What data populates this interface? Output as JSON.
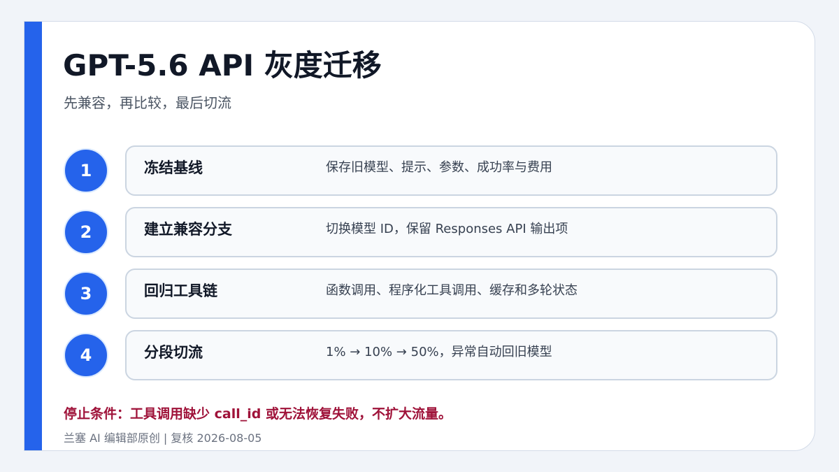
{
  "header": {
    "title": "GPT-5.6 API 灰度迁移",
    "subtitle": "先兼容，再比较，最后切流"
  },
  "steps": [
    {
      "number": "1",
      "name": "冻结基线",
      "description": "保存旧模型、提示、参数、成功率与费用"
    },
    {
      "number": "2",
      "name": "建立兼容分支",
      "description": "切换模型 ID，保留 Responses API 输出项"
    },
    {
      "number": "3",
      "name": "回归工具链",
      "description": "函数调用、程序化工具调用、缓存和多轮状态"
    },
    {
      "number": "4",
      "name": "分段切流",
      "description": "1% → 10% → 50%，异常自动回旧模型"
    }
  ],
  "stop_condition": "停止条件：工具调用缺少 call_id 或无法恢复失败，不扩大流量。",
  "footer": "兰塞 AI 编辑部原创 | 复核 2026-08-05",
  "colors": {
    "accent": "#2563eb",
    "warning": "#9f1239"
  }
}
